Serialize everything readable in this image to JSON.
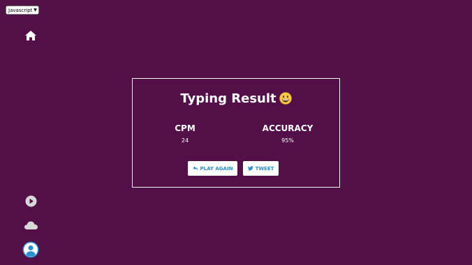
{
  "language_select": {
    "value": "Javascript"
  },
  "sidebar": {
    "home_icon": "home-icon",
    "play_icon": "play-circle-icon",
    "cloud_icon": "cloud-icon",
    "avatar_icon": "user-avatar-icon"
  },
  "result": {
    "title": "Typing Result",
    "title_emoji": "grinning-face-emoji",
    "cpm_label": "CPM",
    "cpm_value": "24",
    "accuracy_label": "ACCURACY",
    "accuracy_value": "95%"
  },
  "actions": {
    "play_again_label": "PLAY AGAIN",
    "play_again_icon": "undo-arrow-icon",
    "tweet_label": "TWEET",
    "tweet_icon": "twitter-icon"
  },
  "colors": {
    "background": "#520f48",
    "button_text": "#2a8fcf",
    "border": "#ffffff",
    "avatar": "#2a8fcf"
  }
}
